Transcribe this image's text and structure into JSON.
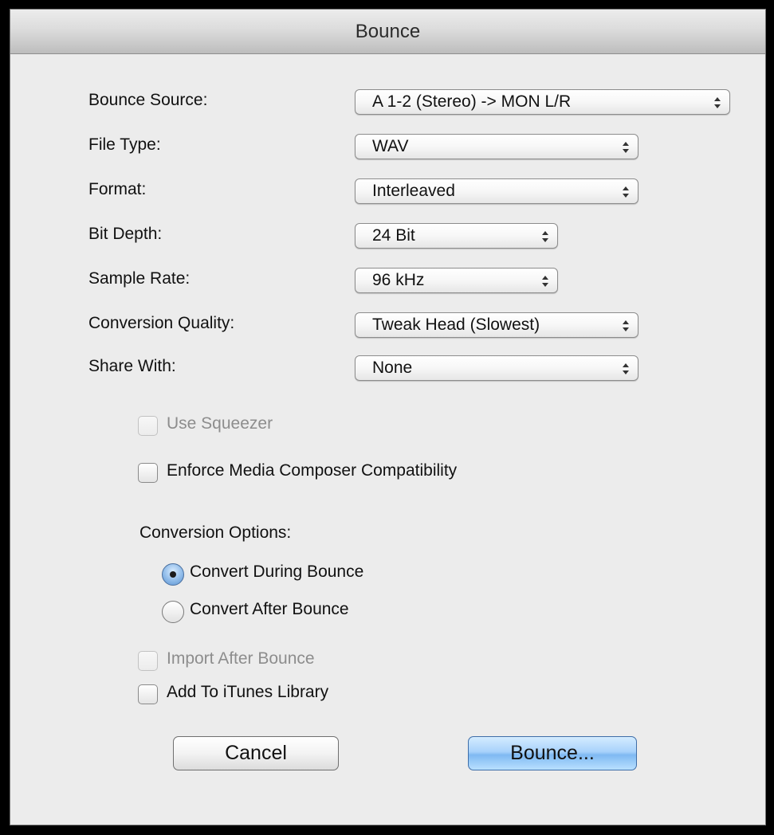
{
  "window": {
    "title": "Bounce"
  },
  "fields": [
    {
      "label": "Bounce Source:",
      "value": "A 1-2 (Stereo) -> MON L/R"
    },
    {
      "label": "File Type:",
      "value": "WAV"
    },
    {
      "label": "Format:",
      "value": "Interleaved"
    },
    {
      "label": "Bit Depth:",
      "value": "24 Bit"
    },
    {
      "label": "Sample Rate:",
      "value": "96 kHz"
    },
    {
      "label": "Conversion Quality:",
      "value": "Tweak Head (Slowest)"
    },
    {
      "label": "Share With:",
      "value": "None"
    }
  ],
  "options": {
    "use_squeezer": {
      "label": "Use Squeezer",
      "checked": false,
      "enabled": false
    },
    "enforce_media_composer": {
      "label": "Enforce Media Composer Compatibility",
      "checked": false,
      "enabled": true
    }
  },
  "conversion_options": {
    "label": "Conversion Options:",
    "choices": [
      {
        "label": "Convert During Bounce",
        "selected": true
      },
      {
        "label": "Convert After Bounce",
        "selected": false
      }
    ]
  },
  "post_options": {
    "import_after_bounce": {
      "label": "Import After Bounce",
      "checked": false,
      "enabled": false
    },
    "add_to_itunes": {
      "label": "Add To iTunes Library",
      "checked": false,
      "enabled": true
    }
  },
  "buttons": {
    "cancel": "Cancel",
    "bounce": "Bounce..."
  },
  "colors": {
    "window_bg": "#ececec",
    "default_button": "#8fc3f6",
    "disabled_text": "#8d8d8d"
  }
}
